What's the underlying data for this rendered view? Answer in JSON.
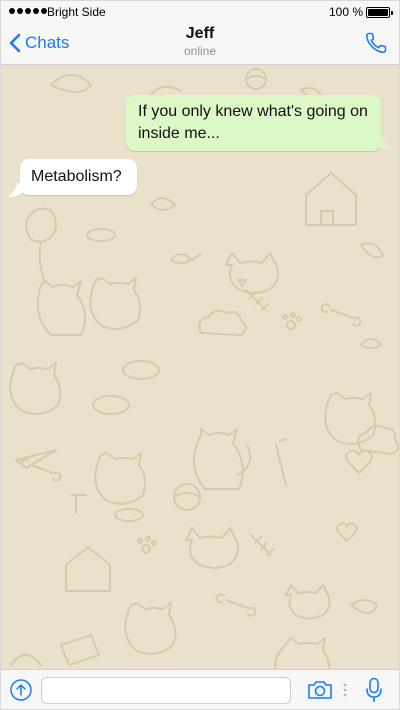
{
  "status_bar": {
    "carrier": "Bright Side",
    "time": "",
    "battery_percent": "100 %",
    "battery_level": 1.0
  },
  "nav": {
    "back_label": "Chats",
    "contact_name": "Jeff",
    "contact_status": "online",
    "accent_color": "#1b7cf2"
  },
  "messages": [
    {
      "direction": "outgoing",
      "text": "If you only knew what's going on inside me..."
    },
    {
      "direction": "incoming",
      "text": "Metabolism?"
    }
  ],
  "input_bar": {
    "placeholder": "",
    "value": "",
    "icons": [
      "arrow-up-icon",
      "camera-icon",
      "microphone-icon"
    ]
  },
  "colors": {
    "outgoing_bubble": "#dcf8c6",
    "incoming_bubble": "#ffffff",
    "chat_background": "#e9e1cc"
  }
}
